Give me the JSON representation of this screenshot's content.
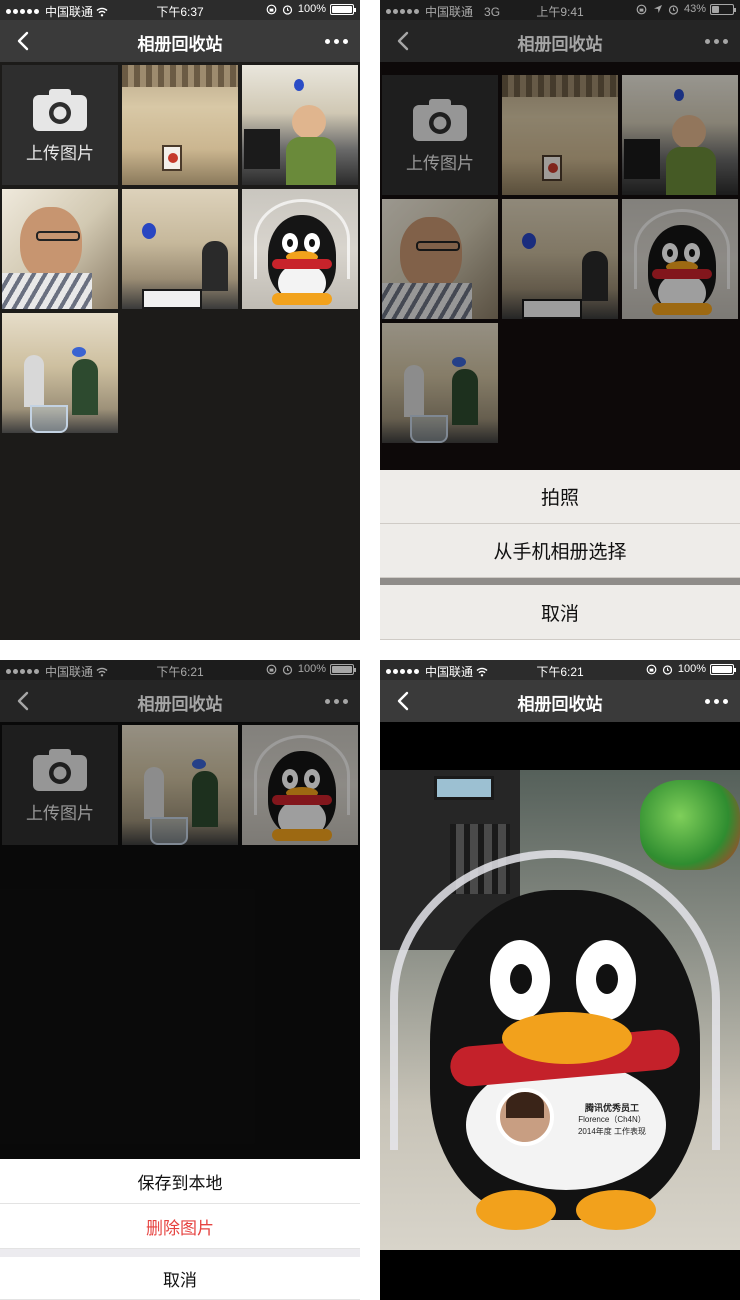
{
  "panels": {
    "tl": {
      "carrier": "中国联通",
      "network": "",
      "time": "下午6:37",
      "battery": "100%",
      "battery_level": 1.0
    },
    "tr": {
      "carrier": "中国联通",
      "network": "3G",
      "time": "上午9:41",
      "battery": "43%",
      "battery_level": 0.43
    },
    "bl": {
      "carrier": "中国联通",
      "network": "",
      "time": "下午6:21",
      "battery": "100%",
      "battery_level": 1.0
    },
    "br": {
      "carrier": "中国联通",
      "network": "",
      "time": "下午6:21",
      "battery": "100%",
      "battery_level": 1.0
    }
  },
  "nav": {
    "title": "相册回收站"
  },
  "upload_label": "上传图片",
  "sheet_photo": {
    "take_photo": "拍照",
    "choose_album": "从手机相册选择",
    "cancel": "取消"
  },
  "sheet_image": {
    "save_local": "保存到本地",
    "delete": "删除图片",
    "cancel": "取消"
  },
  "preview_badge": {
    "title": "腾讯优秀员工",
    "name": "Florence（Ch4N）",
    "sub": "2014年度 工作表现"
  },
  "colors": {
    "nav_bg": "#3a3a3a",
    "danger": "#e64340"
  },
  "icons": [
    "back-icon",
    "more-icon",
    "camera-icon",
    "wifi-icon",
    "alarm-icon",
    "lock-rotation-icon",
    "location-icon"
  ]
}
